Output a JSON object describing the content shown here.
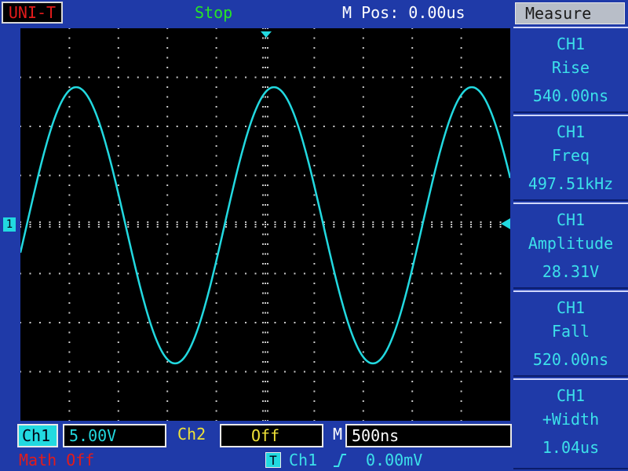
{
  "header": {
    "brand": "UNI-T",
    "run_state": "Stop",
    "horizontal_position": "M Pos: 0.00us"
  },
  "screen": {
    "ch1_marker": "1",
    "trace_color": "#22d9e0",
    "background_color": "#000000",
    "graticule_color": "#c8c8c8"
  },
  "measure_panel": {
    "title": "Measure",
    "measurements": [
      {
        "channel": "CH1",
        "name": "Rise",
        "value": "540.00ns"
      },
      {
        "channel": "CH1",
        "name": "Freq",
        "value": "497.51kHz"
      },
      {
        "channel": "CH1",
        "name": "Amplitude",
        "value": "28.31V"
      },
      {
        "channel": "CH1",
        "name": "Fall",
        "value": "520.00ns"
      },
      {
        "channel": "CH1",
        "name": "+Width",
        "value": "1.04us"
      }
    ]
  },
  "bottom_bar": {
    "ch1_label": "Ch1",
    "ch1_scale": "5.00V",
    "ch2_label": "Ch2",
    "ch2_state": "Off",
    "timebase_label": "M",
    "timebase": "500ns",
    "math_status": "Math Off",
    "trigger_icon": "T",
    "trigger_source": "Ch1",
    "trigger_level": "0.00mV",
    "trigger_slope_icon": "rising-edge-icon"
  },
  "colors": {
    "frame_blue": "#1f3aa8",
    "cyan": "#22d9e0",
    "yellow": "#f0e238",
    "red": "#e31b1b",
    "green": "#27e427"
  }
}
